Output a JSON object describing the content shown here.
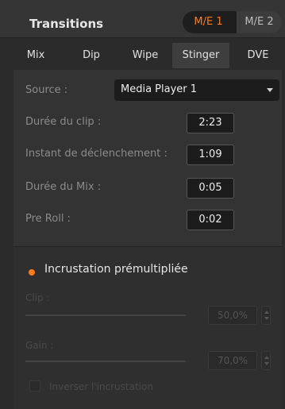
{
  "header": {
    "title": "Transitions",
    "me_tabs": [
      {
        "label": "M/E 1",
        "active": true
      },
      {
        "label": "M/E 2",
        "active": false
      }
    ],
    "accent_color": "#ff7a18"
  },
  "tabs": [
    {
      "label": "Mix",
      "active": false
    },
    {
      "label": "Dip",
      "active": false
    },
    {
      "label": "Wipe",
      "active": false
    },
    {
      "label": "Stinger",
      "active": true
    },
    {
      "label": "DVE",
      "active": false
    }
  ],
  "settings": {
    "source_label": "Source :",
    "source_value": "Media Player 1",
    "clip_duration_label": "Durée du clip :",
    "clip_duration_value": "2:23",
    "trigger_label": "Instant de déclenchement :",
    "trigger_value": "1:09",
    "mix_duration_label": "Durée du Mix :",
    "mix_duration_value": "0:05",
    "preroll_label": "Pre Roll :",
    "preroll_value": "0:02"
  },
  "incrustation": {
    "title": "Incrustation prémultipliée",
    "selected": true,
    "clip_label": "Clip :",
    "clip_value": "50,0%",
    "clip_level": 0.5,
    "gain_label": "Gain :",
    "gain_value": "70,0%",
    "gain_level": 0.7,
    "invert_label": "Inverser l'incrustation",
    "invert_checked": false
  }
}
